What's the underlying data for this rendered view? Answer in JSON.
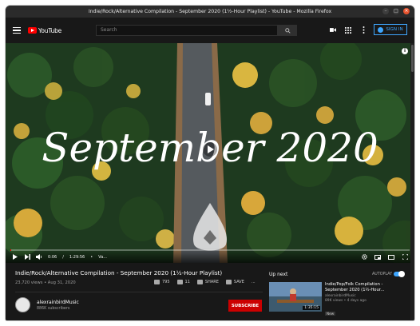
{
  "window": {
    "title": "Indie/Rock/Alternative Compilation - September 2020 (1½-Hour Playlist) - YouTube - Mozilla Firefox"
  },
  "header": {
    "logo_text": "YouTube",
    "search_placeholder": "Search",
    "signin_label": "SIGN IN",
    "icons": [
      "video-camera-icon",
      "apps-grid-icon",
      "more-vert-icon"
    ]
  },
  "player": {
    "overlay_text": "September 2020",
    "time_current": "0:06",
    "time_total": "1:29:56",
    "chapter": "Va...",
    "progress": 0.001,
    "colors": {
      "progress": "#ff0000"
    }
  },
  "video": {
    "title": "Indie/Rock/Alternative Compilation - September 2020 (1½-Hour Playlist)",
    "meta": "23,720 views • Aug 31, 2020",
    "likes": "795",
    "dislikes": "11",
    "share_label": "SHARE",
    "save_label": "SAVE",
    "more_label": "..."
  },
  "channel": {
    "name": "alexrainbirdMusic",
    "subscribers": "886K subscribers",
    "subscribe_label": "SUBSCRIBE"
  },
  "sidebar": {
    "up_next_label": "Up next",
    "autoplay_label": "AUTOPLAY",
    "autoplay_on": true,
    "recommendation": {
      "title": "Indie/Pop/Folk Compilation - September 2020 (1½-Hour...",
      "channel": "alexrainbirdMusic",
      "meta": "89K views • 4 days ago",
      "badge": "New",
      "duration": "1:35:15"
    }
  },
  "colors": {
    "brand": "#ff0000",
    "accent": "#3ea6ff",
    "subscribe": "#cc0000"
  }
}
